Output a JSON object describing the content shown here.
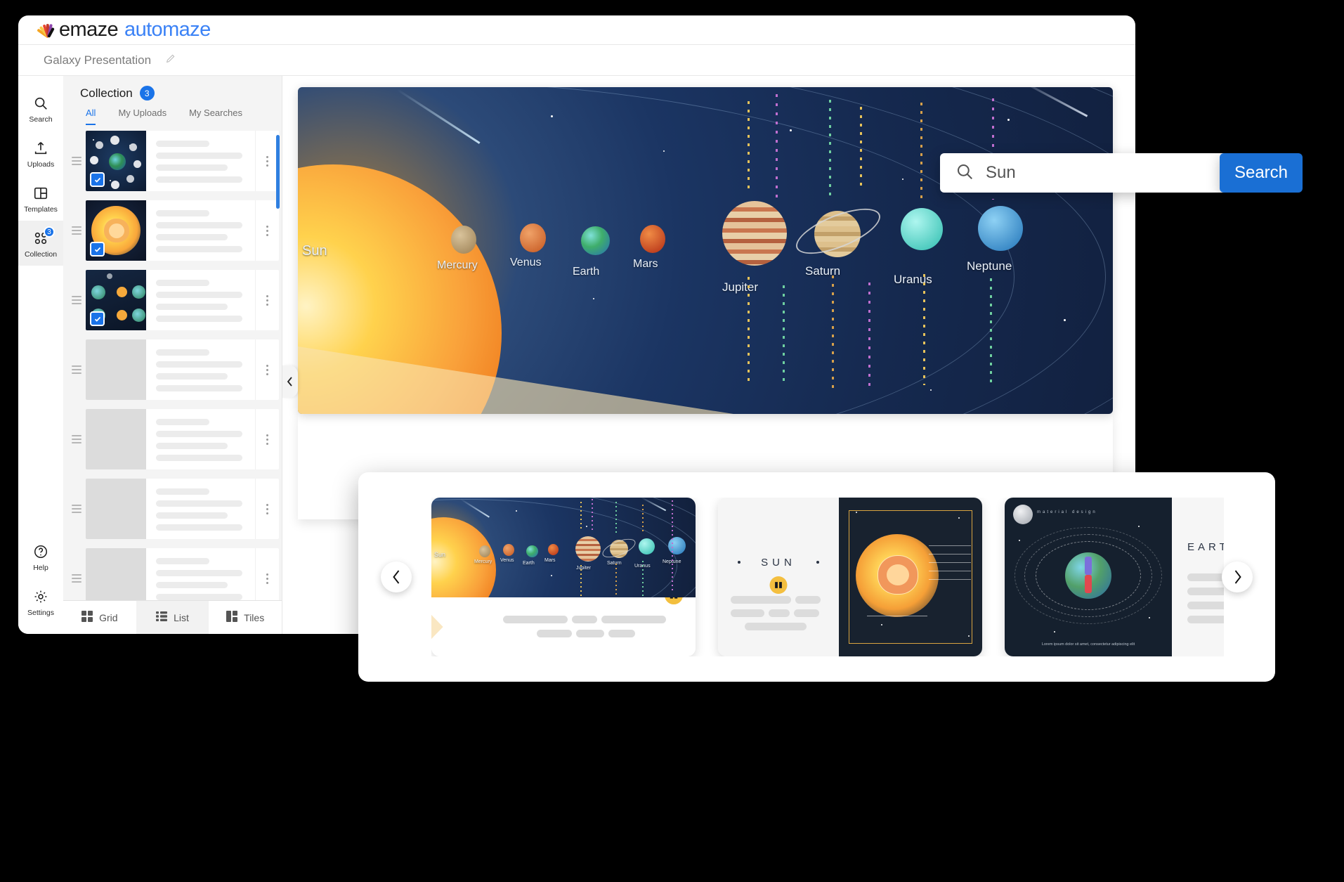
{
  "brand": {
    "logo_icon": "emaze-peacock-icon",
    "name_primary": "emaze",
    "name_secondary": "automaze"
  },
  "document": {
    "title": "Galaxy Presentation",
    "edit_icon": "pencil-icon"
  },
  "rail": {
    "items": [
      {
        "label": "Search",
        "icon": "search-icon",
        "badge": "",
        "active": false
      },
      {
        "label": "Uploads",
        "icon": "upload-icon",
        "badge": "",
        "active": false
      },
      {
        "label": "Templates",
        "icon": "templates-icon",
        "badge": "",
        "active": false
      },
      {
        "label": "Collection",
        "icon": "collection-icon",
        "badge": "3",
        "active": true
      }
    ],
    "bottom": [
      {
        "label": "Help",
        "icon": "help-circle-icon"
      },
      {
        "label": "Settings",
        "icon": "gear-icon"
      }
    ]
  },
  "panel": {
    "title": "Collection",
    "count": "3",
    "tabs": [
      {
        "label": "All",
        "active": true
      },
      {
        "label": "My Uploads",
        "active": false
      },
      {
        "label": "My Searches",
        "active": false
      }
    ],
    "items": [
      {
        "name": "moon-phases-thumb",
        "checked": true
      },
      {
        "name": "sun-layers-thumb",
        "checked": true
      },
      {
        "name": "eclipse-diagram-thumb",
        "checked": true
      },
      {
        "name": "placeholder-thumb-4",
        "checked": false
      },
      {
        "name": "placeholder-thumb-5",
        "checked": false
      },
      {
        "name": "placeholder-thumb-6",
        "checked": false
      },
      {
        "name": "placeholder-thumb-7",
        "checked": false
      }
    ],
    "view_tabs": [
      {
        "label": "Grid",
        "icon": "grid-icon",
        "active": false
      },
      {
        "label": "List",
        "icon": "list-icon",
        "active": true
      },
      {
        "label": "Tiles",
        "icon": "tiles-icon",
        "active": false
      }
    ],
    "collapse_icon": "chevron-left-icon"
  },
  "search": {
    "value": "Sun",
    "placeholder": "Search",
    "button_label": "Search",
    "icon": "search-icon",
    "accent": "#1a6fd4"
  },
  "slide": {
    "title": "Sun",
    "planets": [
      {
        "label": "Sun"
      },
      {
        "label": "Mercury"
      },
      {
        "label": "Venus"
      },
      {
        "label": "Earth"
      },
      {
        "label": "Mars"
      },
      {
        "label": "Jupiter"
      },
      {
        "label": "Saturn"
      },
      {
        "label": "Uranus"
      },
      {
        "label": "Neptune"
      }
    ]
  },
  "carousel": {
    "prev_icon": "chevron-left-icon",
    "next_icon": "chevron-right-icon",
    "cards": [
      {
        "name": "solar-system-card",
        "title": "",
        "planets": [
          "Sun",
          "Mercury",
          "Venus",
          "Earth",
          "Mars",
          "Jupiter",
          "Saturn",
          "Uranus",
          "Neptune"
        ],
        "badge_icon": "book-icon"
      },
      {
        "name": "sun-card",
        "title": "SUN",
        "badge_icon": "book-icon"
      },
      {
        "name": "earth-card",
        "title": "EARTH",
        "watermark": "material design",
        "caption": "Lorem ipsum dolor sit amet, consectetur adipiscing elit"
      }
    ]
  },
  "colors": {
    "accent_blue": "#1a73e8",
    "search_blue": "#1a6fd4",
    "panel_bg": "#f4f4f4"
  }
}
